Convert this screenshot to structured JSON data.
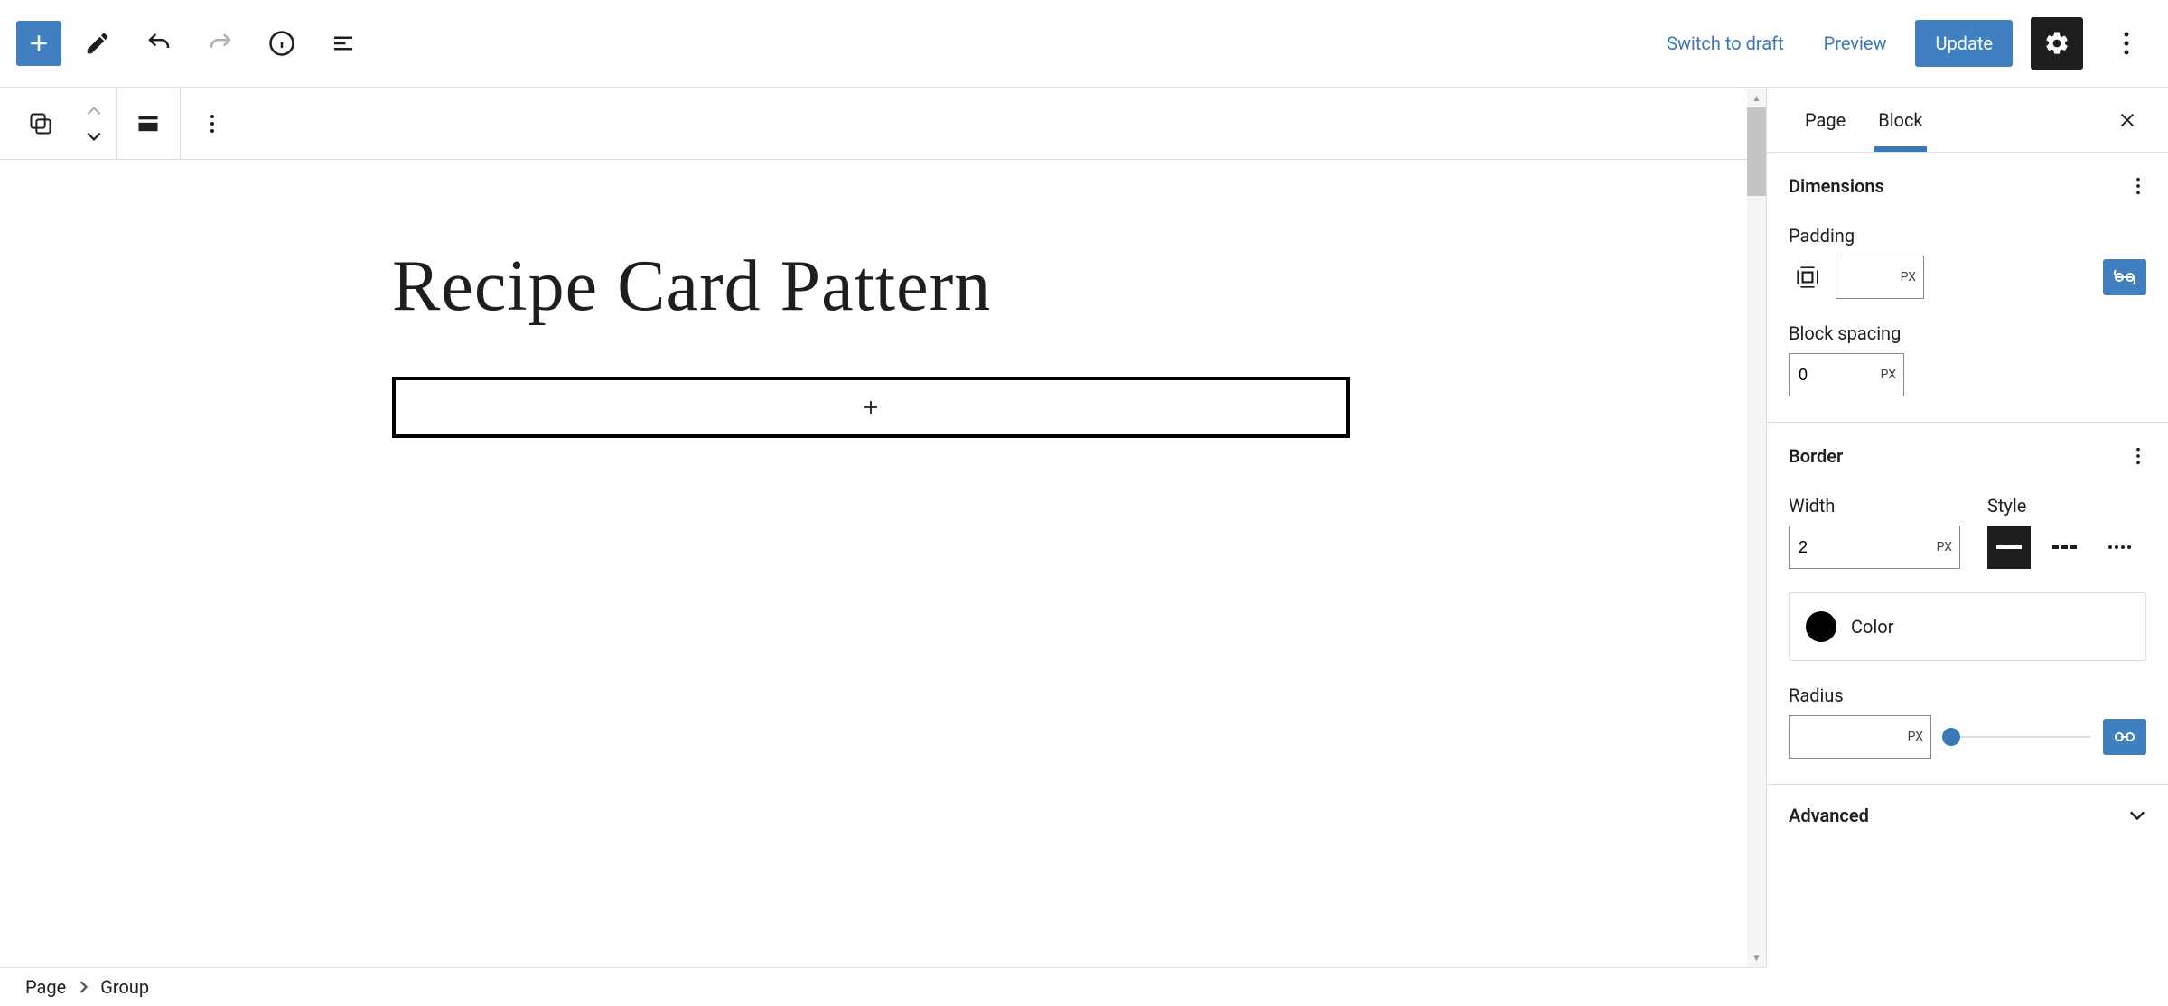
{
  "header": {
    "switch_to_draft": "Switch to draft",
    "preview": "Preview",
    "update": "Update"
  },
  "canvas": {
    "page_title": "Recipe Card Pattern"
  },
  "sidebar": {
    "tabs": {
      "page": "Page",
      "block": "Block"
    },
    "dimensions": {
      "title": "Dimensions",
      "padding_label": "Padding",
      "padding_value": "",
      "padding_unit": "PX",
      "block_spacing_label": "Block spacing",
      "block_spacing_value": "0",
      "block_spacing_unit": "PX"
    },
    "border": {
      "title": "Border",
      "width_label": "Width",
      "width_value": "2",
      "width_unit": "PX",
      "style_label": "Style",
      "color_label": "Color",
      "color_value": "#000000",
      "radius_label": "Radius",
      "radius_value": "",
      "radius_unit": "PX"
    },
    "advanced": {
      "title": "Advanced"
    }
  },
  "footer": {
    "crumb1": "Page",
    "crumb2": "Group"
  }
}
